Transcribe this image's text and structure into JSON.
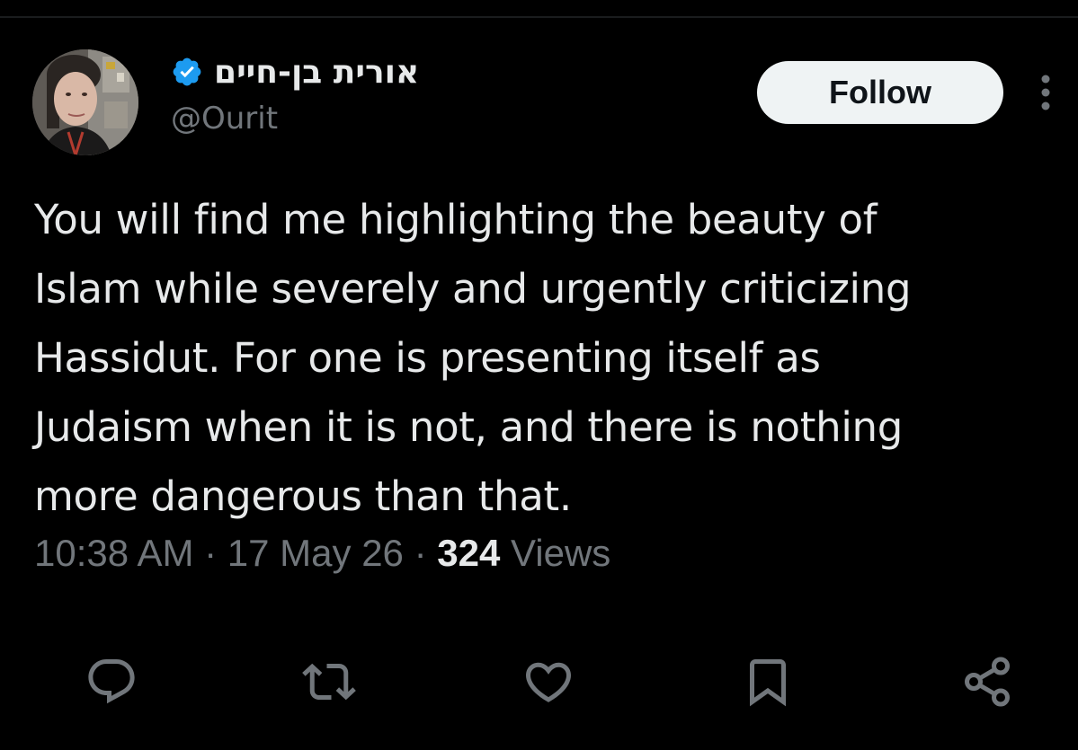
{
  "author": {
    "display_name": "אורית בן-חיים",
    "handle": "@Ourit",
    "verified": true,
    "verified_color": "#1d9bf0"
  },
  "follow_button": {
    "label": "Follow"
  },
  "tweet": {
    "text_lines": [
      "You will find me highlighting the beauty of",
      "Islam while severely and urgently criticizing",
      "Hassidut. For one is presenting itself as",
      "Judaism when it is not, and there is nothing",
      "more dangerous than that."
    ]
  },
  "meta": {
    "time": "10:38 AM",
    "separator": " · ",
    "date": "17 May 26",
    "views_count": "324",
    "views_label": " Views"
  },
  "actions": [
    {
      "name": "reply",
      "icon": "reply-icon"
    },
    {
      "name": "repost",
      "icon": "repost-icon"
    },
    {
      "name": "like",
      "icon": "heart-icon"
    },
    {
      "name": "bookmark",
      "icon": "bookmark-icon"
    },
    {
      "name": "share",
      "icon": "share-icon"
    }
  ],
  "colors": {
    "background": "#000000",
    "primary_text": "#e7e9ea",
    "secondary_text": "#71767b",
    "follow_bg": "#eff3f4"
  }
}
